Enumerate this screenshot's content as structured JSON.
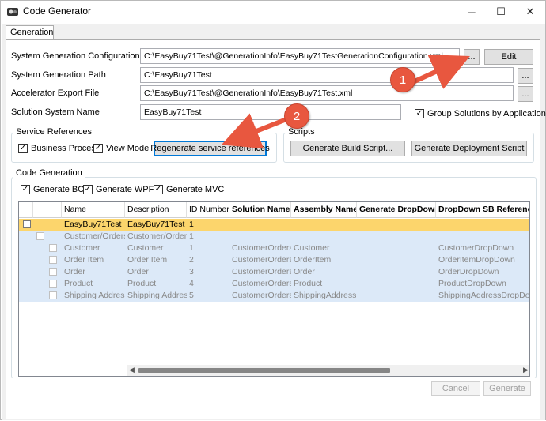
{
  "window": {
    "title": "Code Generator",
    "minimize": "─",
    "maximize": "☐",
    "close": "✕"
  },
  "tab": {
    "label": "Generation"
  },
  "fields": {
    "config_label": "System Generation Configuration File",
    "config_value": "C:\\EasyBuy71Test\\@GenerationInfo\\EasyBuy71TestGenerationConfiguration.xml",
    "path_label": "System Generation Path",
    "path_value": "C:\\EasyBuy71Test",
    "export_label": "Accelerator Export File",
    "export_value": "C:\\EasyBuy71Test\\@GenerationInfo\\EasyBuy71Test.xml",
    "solution_label": "Solution System Name",
    "solution_value": "EasyBuy71Test",
    "group_solutions_label": "Group Solutions by Application"
  },
  "buttons": {
    "browse": "...",
    "edit": "Edit",
    "cancel": "Cancel",
    "generate": "Generate"
  },
  "service_refs": {
    "title": "Service References",
    "business_process": "Business Process",
    "view_model": "View Model",
    "regenerate": "Regenerate service references"
  },
  "scripts": {
    "title": "Scripts",
    "build": "Generate Build Script...",
    "deployment": "Generate Deployment Script"
  },
  "code_gen": {
    "title": "Code Generation",
    "bos": "Generate BOS",
    "wpf": "Generate WPF",
    "mvc": "Generate MVC"
  },
  "grid": {
    "columns": [
      "Name",
      "Description",
      "ID Number",
      "Solution Name",
      "Assembly Name",
      "Generate DropDown",
      "DropDown SB Reference"
    ],
    "rows": [
      {
        "name": "EasyBuy71Test",
        "description": "EasyBuy71Test",
        "id": "1",
        "solution": "",
        "assembly": "",
        "dropdown_ref": ""
      },
      {
        "name": "Customer/Orders",
        "description": "Customer/Orders",
        "id": "1",
        "solution": "",
        "assembly": "",
        "dropdown_ref": ""
      },
      {
        "name": "Customer",
        "description": "Customer",
        "id": "1",
        "solution": "CustomerOrders",
        "assembly": "Customer",
        "dropdown_ref": "CustomerDropDown"
      },
      {
        "name": "Order Item",
        "description": "Order Item",
        "id": "2",
        "solution": "CustomerOrders",
        "assembly": "OrderItem",
        "dropdown_ref": "OrderItemDropDown"
      },
      {
        "name": "Order",
        "description": "Order",
        "id": "3",
        "solution": "CustomerOrders",
        "assembly": "Order",
        "dropdown_ref": "OrderDropDown"
      },
      {
        "name": "Product",
        "description": "Product",
        "id": "4",
        "solution": "CustomerOrders",
        "assembly": "Product",
        "dropdown_ref": "ProductDropDown"
      },
      {
        "name": "Shipping Address",
        "description": "Shipping Address",
        "id": "5",
        "solution": "CustomerOrders",
        "assembly": "ShippingAddress",
        "dropdown_ref": "ShippingAddressDropDown"
      }
    ]
  },
  "callouts": {
    "one": "1",
    "two": "2"
  },
  "colors": {
    "selected_row": "#fcd56c",
    "group_row": "#dce9f8",
    "child_row": "#dce9f8",
    "callout": "#e8573f",
    "accent": "#0078d7"
  }
}
